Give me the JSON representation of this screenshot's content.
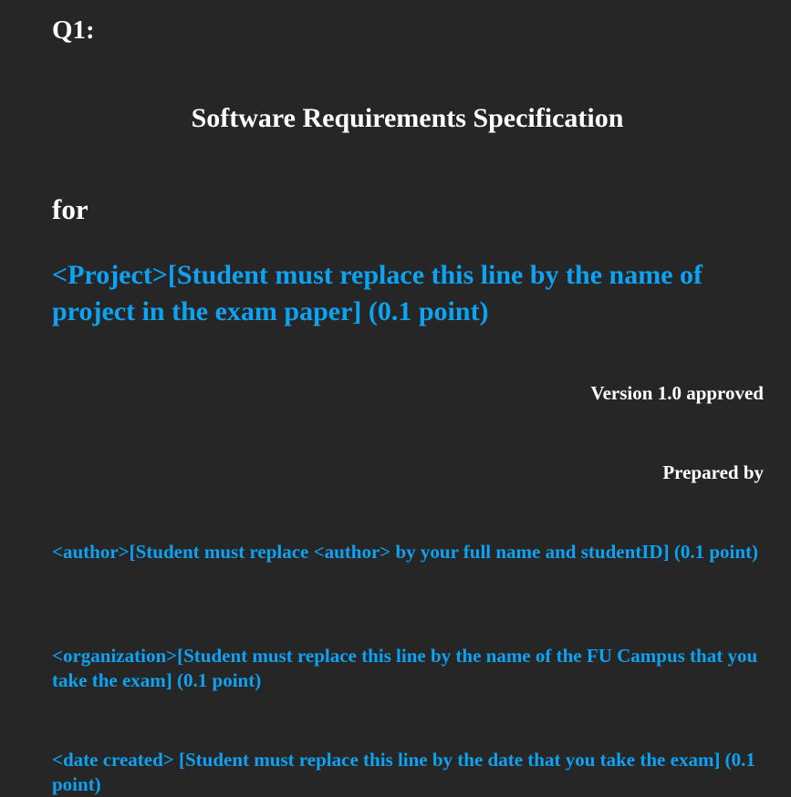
{
  "question_label": "Q1:",
  "title": "Software Requirements Specification",
  "for_label": "for",
  "project_line": "<Project>[Student must replace this line by the name of project in the exam paper] (0.1 point)",
  "version": "Version 1.0 approved",
  "prepared_by": "Prepared by",
  "author_line": "<author>[Student must replace <author> by your full name and studentID] (0.1 point)",
  "organization_line": "<organization>[Student must replace this line by the name of the FU Campus that you take the exam] (0.1 point)",
  "date_line": "<date created> [Student must replace this line by the date that you take the exam] (0.1 point)",
  "colors": {
    "background": "#262626",
    "text": "#ffffff",
    "placeholder_accent": "#0da2f2"
  }
}
